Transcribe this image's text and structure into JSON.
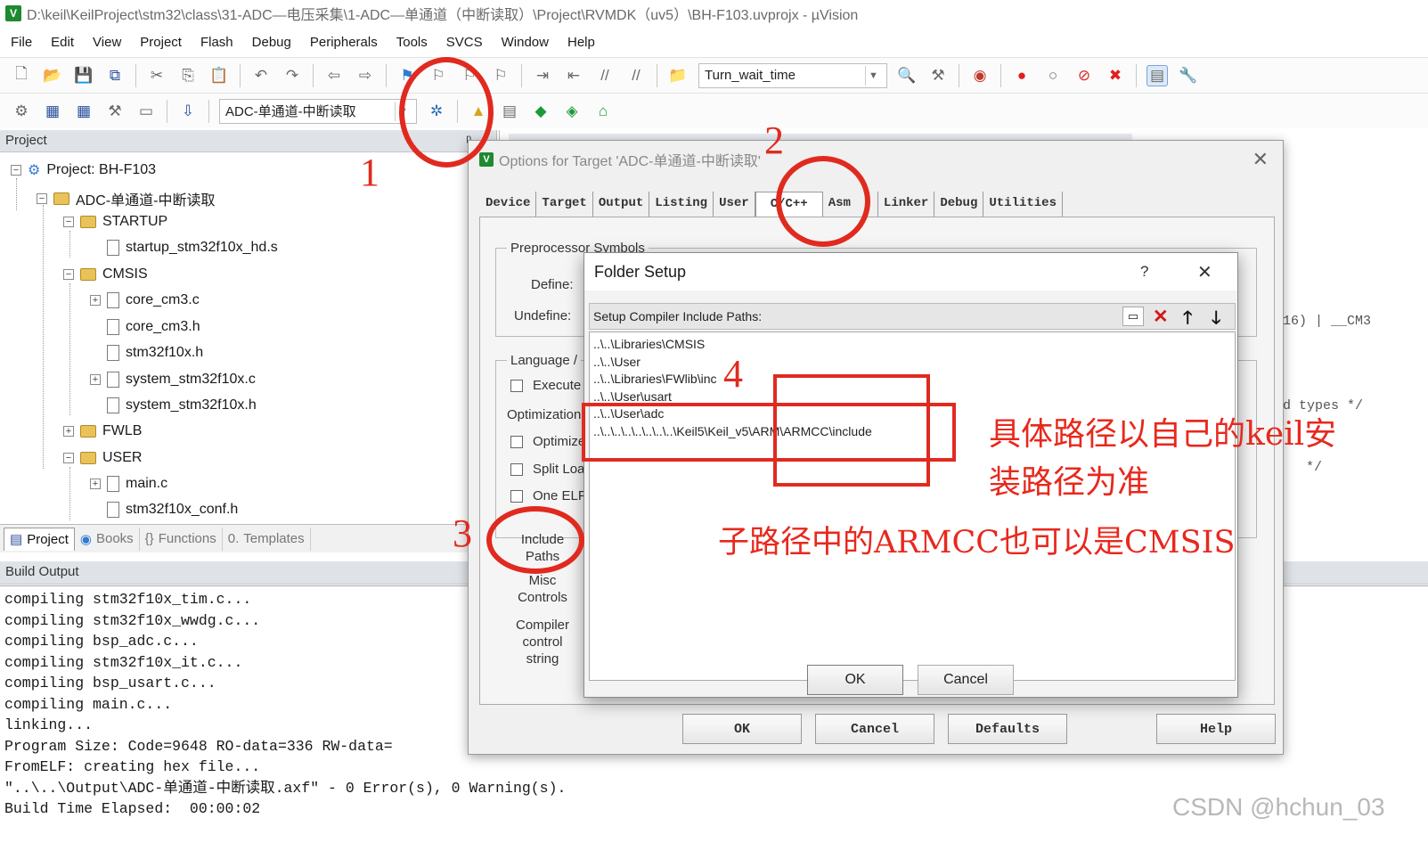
{
  "title": "D:\\keil\\KeilProject\\stm32\\class\\31-ADC—电压采集\\1-ADC—单通道（中断读取）\\Project\\RVMDK（uv5）\\BH-F103.uvprojx - µVision",
  "menu": [
    "File",
    "Edit",
    "View",
    "Project",
    "Flash",
    "Debug",
    "Peripherals",
    "Tools",
    "SVCS",
    "Window",
    "Help"
  ],
  "toolbar1": {
    "find_combo": "Turn_wait_time"
  },
  "toolbar2": {
    "target_combo": "ADC-单通道-中断读取"
  },
  "project_panel": {
    "title": "Project",
    "pin": "ᵖ",
    "tree": [
      "Project: BH-F103",
      "ADC-单通道-中断读取",
      "STARTUP",
      "startup_stm32f10x_hd.s",
      "CMSIS",
      "core_cm3.c",
      "core_cm3.h",
      "stm32f10x.h",
      "system_stm32f10x.c",
      "system_stm32f10x.h",
      "FWLB",
      "USER",
      "main.c",
      "stm32f10x_conf.h"
    ],
    "tabs": [
      "Project",
      "Books",
      "Functions",
      "Templates"
    ]
  },
  "build_output": {
    "title": "Build Output",
    "lines": [
      "compiling stm32f10x_tim.c...",
      "compiling stm32f10x_wwdg.c...",
      "compiling bsp_adc.c...",
      "compiling stm32f10x_it.c...",
      "compiling bsp_usart.c...",
      "compiling main.c...",
      "linking...",
      "Program Size: Code=9648 RO-data=336 RW-data=",
      "FromELF: creating hex file...",
      "\"..\\..\\Output\\ADC-单通道-中断读取.axf\" - 0 Error(s), 0 Warning(s).",
      "Build Time Elapsed:  00:00:02"
    ]
  },
  "editor": {
    "code_fragments": [
      "16) | __CM3",
      "d types */",
      "*/"
    ]
  },
  "options_dialog": {
    "title": "Options for Target 'ADC-单通道-中断读取'",
    "tabs": [
      "Device",
      "Target",
      "Output",
      "Listing",
      "User",
      "C/C++",
      "Asm",
      "Linker",
      "Debug",
      "Utilities"
    ],
    "preprocessor_group": "Preprocessor Symbols",
    "define_label": "Define:",
    "undefine_label": "Undefine:",
    "language_group": "Language /",
    "execute_label": "Execute",
    "optimization_label": "Optimization:",
    "optimize_label": "Optimize",
    "split_label": "Split Loa",
    "one_elf_label": "One ELF",
    "include_paths_label": "Include Paths",
    "misc_controls_label": "Misc Controls",
    "compiler_control_label": "Compiler control string",
    "buttons": {
      "ok": "OK",
      "cancel": "Cancel",
      "defaults": "Defaults",
      "help": "Help"
    }
  },
  "folder_setup": {
    "title": "Folder Setup",
    "help": "?",
    "close": "✕",
    "list_label": "Setup Compiler Include Paths:",
    "paths": [
      "..\\..\\Libraries\\CMSIS",
      "..\\..\\User",
      "..\\..\\Libraries\\FWlib\\inc",
      "..\\..\\User\\usart",
      "..\\..\\User\\adc",
      "..\\..\\..\\..\\..\\..\\..\\..\\Keil5\\Keil_v5\\ARM\\ARMCC\\include"
    ],
    "ok": "OK",
    "cancel": "Cancel"
  },
  "annotations": {
    "n1": "1",
    "n2": "2",
    "n3": "3",
    "n4": "4",
    "note1_line1": "具体路径以自己的keil安",
    "note1_line2": "装路径为准",
    "note2": "子路径中的ARMCC也可以是CMSIS"
  },
  "watermark": "CSDN @hchun_03"
}
